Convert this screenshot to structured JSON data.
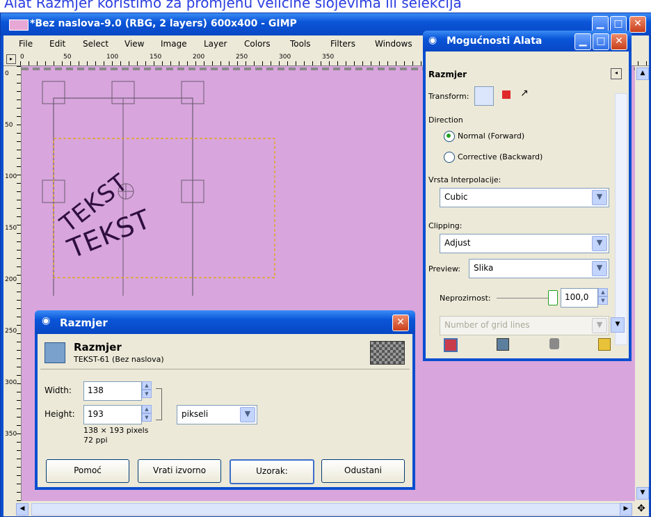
{
  "caption": "Alat Razmjer koristimo za promjenu veličine slojevima ili selekcija",
  "window": {
    "title": "*Bez naslova-9.0 (RBG, 2 layers) 600x400 - GIMP",
    "min_glyph": "▁",
    "max_glyph": "□",
    "close_glyph": "✕"
  },
  "menu": [
    "File",
    "Edit",
    "Select",
    "View",
    "Image",
    "Layer",
    "Colors",
    "Tools",
    "Filters",
    "Windows"
  ],
  "ruler_top": [
    "0",
    "50",
    "100",
    "150",
    "200",
    "250",
    "300",
    "350"
  ],
  "ruler_left": [
    "0",
    "50",
    "100",
    "150",
    "200",
    "250",
    "300",
    "350"
  ],
  "canvas": {
    "text_a": "TEKST",
    "text_b": "TEKST",
    "bg_color": "#d8a5dd"
  },
  "tool_options": {
    "title": "Mogućnosti Alata",
    "heading": "Razmjer",
    "transform_label": "Transform:",
    "direction_label": "Direction",
    "dir_normal": "Normal (Forward)",
    "dir_corrective": "Corrective (Backward)",
    "interp_label": "Vrsta Interpolacije:",
    "interp_value": "Cubic",
    "clipping_label": "Clipping:",
    "clipping_value": "Adjust",
    "preview_label": "Preview:",
    "preview_value": "Slika",
    "opacity_label": "Neprozirnost:",
    "opacity_value": "100,0",
    "grid_placeholder": "Number of grid lines"
  },
  "scale_dialog": {
    "title": "Razmjer",
    "heading": "Razmjer",
    "subheading": "TEKST-61 (Bez naslova)",
    "width_label": "Width:",
    "width_value": "138",
    "height_label": "Height:",
    "height_value": "193",
    "unit": "pikseli",
    "info_size": "138 × 193 pixels",
    "info_res": "72 ppi",
    "buttons": [
      "Pomoć",
      "Vrati izvorno",
      "Uzorak:",
      "Odustani"
    ]
  }
}
